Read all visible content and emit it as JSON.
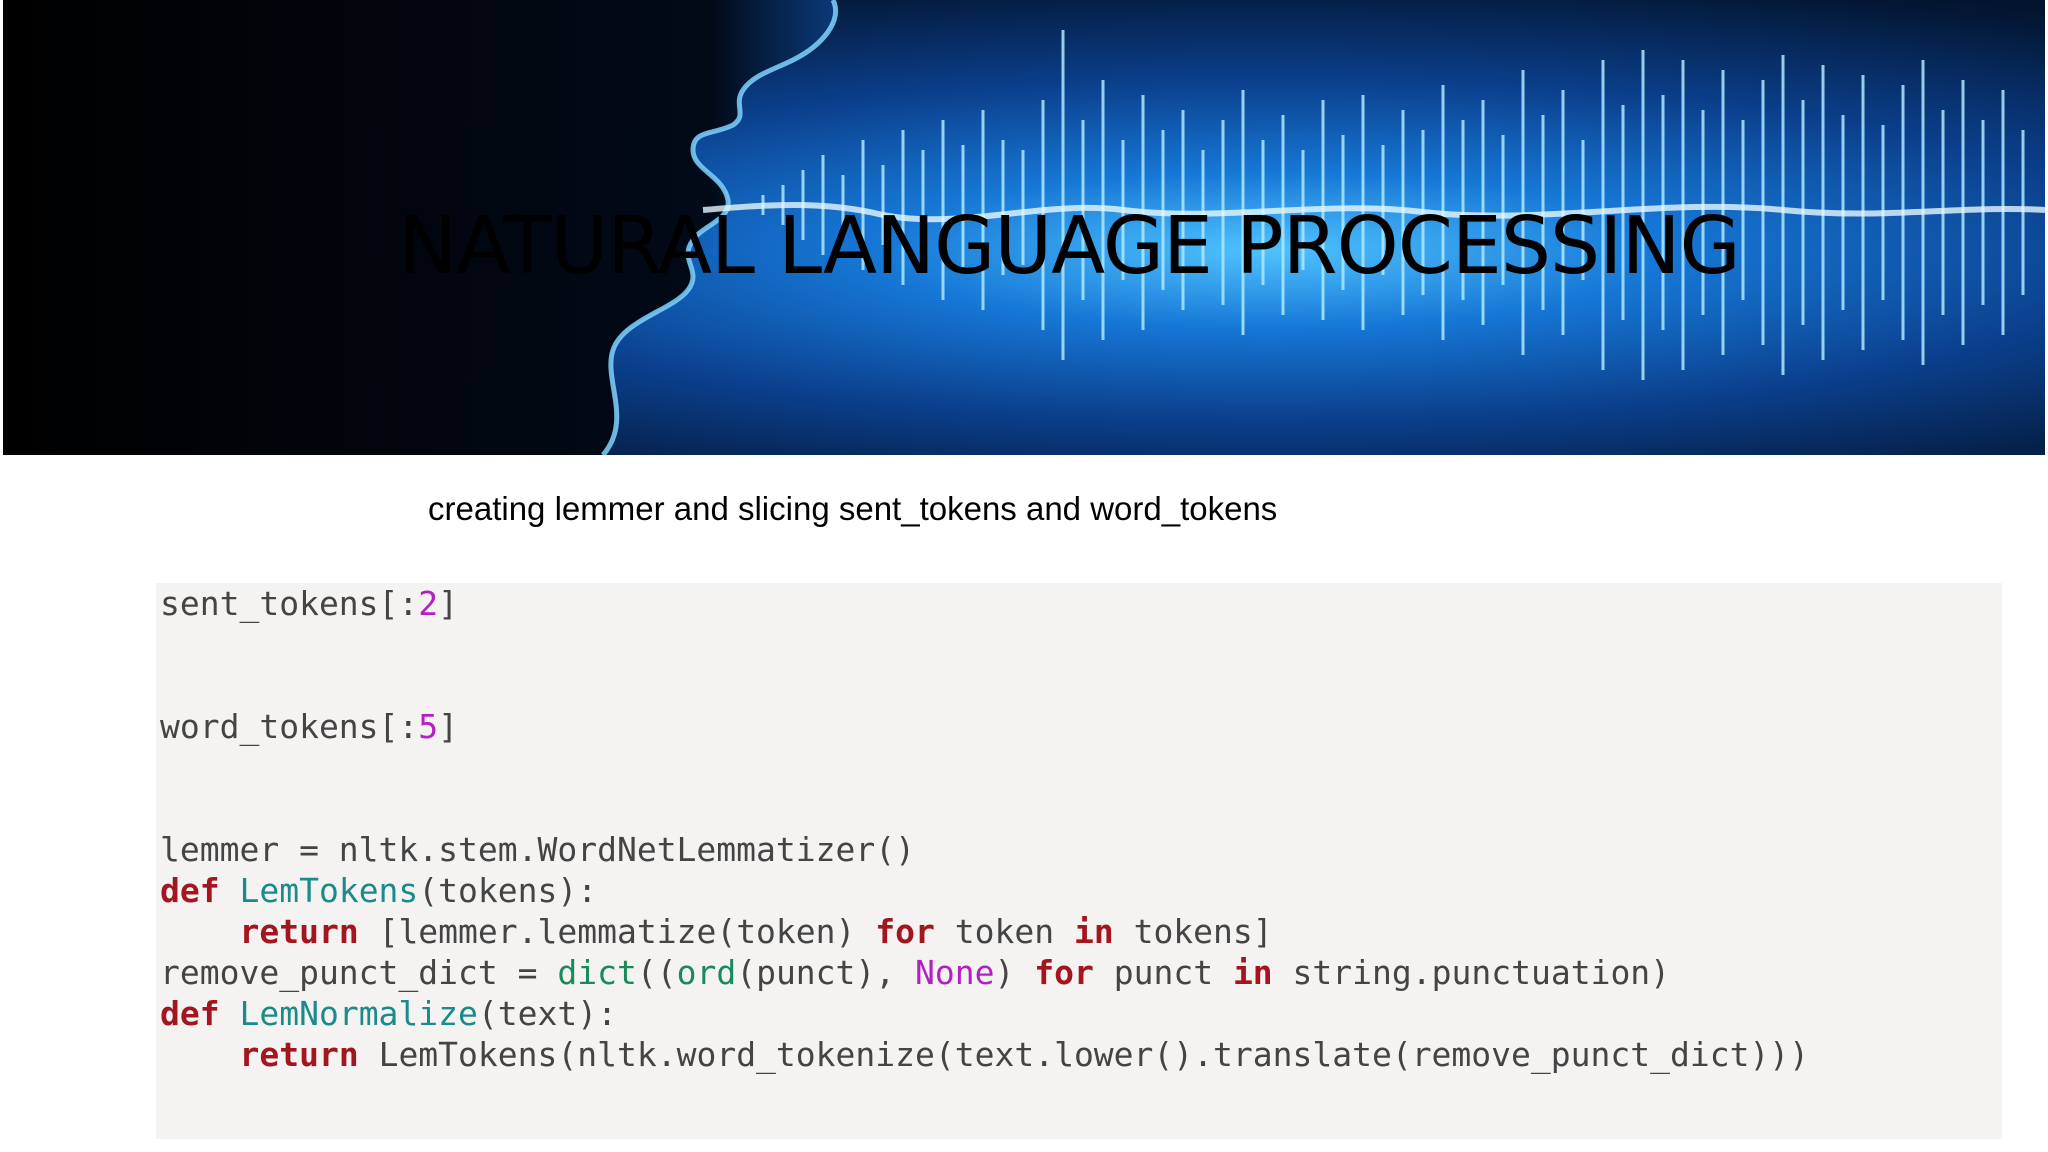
{
  "banner": {
    "title": "NATURAL LANGUAGE PROCESSING"
  },
  "subtitle": "creating lemmer and slicing sent_tokens and word_tokens",
  "code": {
    "line1": {
      "name": "sent_tokens",
      "open": "[:",
      "num": "2",
      "close": "]"
    },
    "line2": {
      "name": "word_tokens",
      "open": "[:",
      "num": "5",
      "close": "]"
    },
    "line3": {
      "text": "lemmer = nltk.stem.WordNetLemmatizer()"
    },
    "line4": {
      "kw": "def",
      "fn": "LemTokens",
      "rest": "(tokens):"
    },
    "line5": {
      "indent": "    ",
      "kw_return": "return",
      "part1": " [lemmer.lemmatize(token) ",
      "kw_for": "for",
      "part2": " token ",
      "kw_in": "in",
      "part3": " tokens]"
    },
    "line6": {
      "part1": "remove_punct_dict = ",
      "dict": "dict",
      "part2": "((",
      "ord": "ord",
      "part3": "(punct), ",
      "none": "None",
      "part4": ") ",
      "kw_for": "for",
      "part5": " punct ",
      "kw_in": "in",
      "part6": " string.punctuation)"
    },
    "line7": {
      "kw": "def",
      "fn": "LemNormalize",
      "rest": "(text):"
    },
    "line8": {
      "indent": "    ",
      "kw_return": "return",
      "rest": " LemTokens(nltk.word_tokenize(text.lower().translate(remove_punct_dict)))"
    }
  },
  "colors": {
    "keyword": "#a3161f",
    "function_name": "#1a8a8a",
    "builtin": "#198a58",
    "number": "#b320c2",
    "code_background": "#f5f3f2"
  }
}
